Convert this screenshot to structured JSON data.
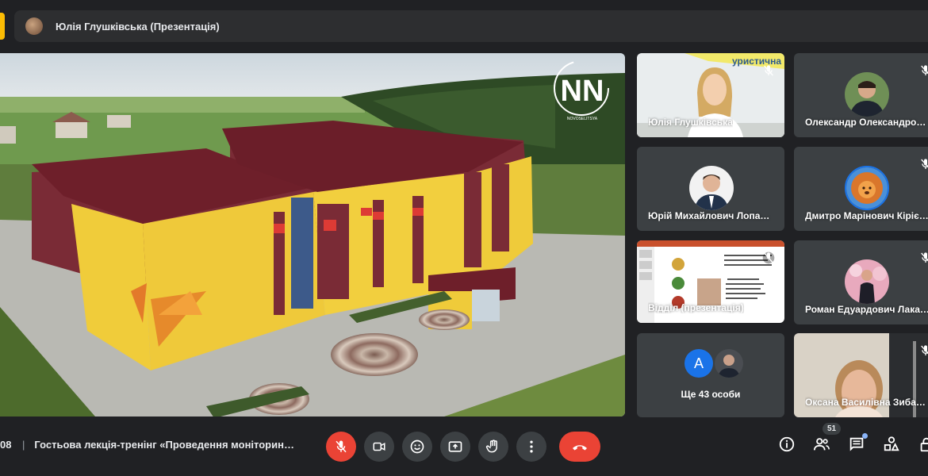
{
  "presenter": {
    "name": "Юлія Глушківська (Презентація)"
  },
  "stage": {
    "watermark": "NN",
    "watermark_sub": "NOVOSELITSYA"
  },
  "tiles": [
    {
      "name": "Юлія Глушківська",
      "muted": true
    },
    {
      "name": "Олександр Олександрович",
      "muted": true
    },
    {
      "name": "Юрій Михайлович Лопатинський",
      "muted": false
    },
    {
      "name": "Дмитро Марінович Кірієнко",
      "muted": true
    },
    {
      "name": "Відділ (презентація)",
      "muted": true
    },
    {
      "name": "Роман Едуардович Лакатош",
      "muted": true
    },
    {
      "name": "Ще 43 особи",
      "avatar_letter": "A"
    },
    {
      "name": "Оксана Василівна Зибарева",
      "muted": true
    }
  ],
  "meeting": {
    "time": "08",
    "separator": "|",
    "title": "Гостьова лекція-тренінг «Проведення моніторингу»"
  },
  "people_count": "51",
  "colors": {
    "accent": "#fbbc04",
    "danger": "#ea4335",
    "tile_bg": "#3c4043",
    "bg": "#202124",
    "blue": "#1a73e8"
  }
}
